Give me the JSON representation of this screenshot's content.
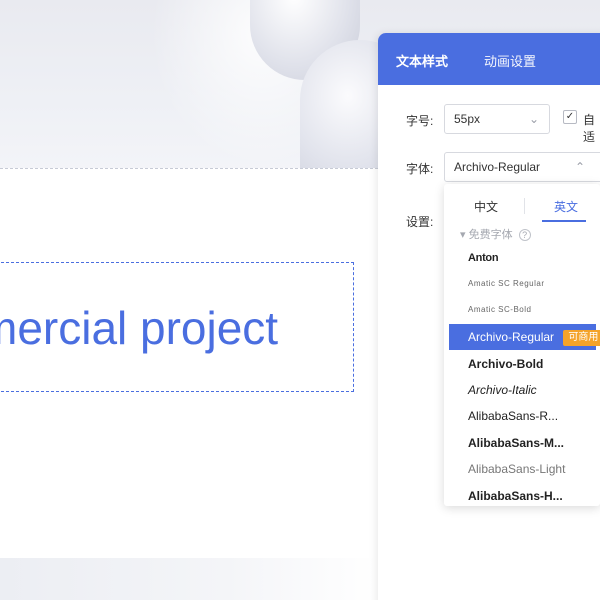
{
  "canvas": {
    "text": "mercial project",
    "text_color": "#4a6ee0"
  },
  "panel": {
    "tabs": [
      {
        "label": "文本样式"
      },
      {
        "label": "动画设置"
      }
    ],
    "accent": "#4a6ee0",
    "font_size": {
      "label": "字号:",
      "value": "55px",
      "auto_label": "自适"
    },
    "font_family": {
      "label": "字体:",
      "value": "Archivo-Regular"
    },
    "settings_label": "设置:"
  },
  "dropdown": {
    "tabs": [
      {
        "label": "中文"
      },
      {
        "label": "英文"
      }
    ],
    "group_label": "免费字体",
    "help_icon": "?",
    "badge": "可商用",
    "fonts": [
      {
        "label": "Anton"
      },
      {
        "label": "Amatic SC Regular"
      },
      {
        "label": "Amatic SC-Bold"
      },
      {
        "label": "Archivo-Regular"
      },
      {
        "label": "Archivo-Bold"
      },
      {
        "label": "Archivo-Italic"
      },
      {
        "label": "AlibabaSans-R..."
      },
      {
        "label": "AlibabaSans-M..."
      },
      {
        "label": "AlibabaSans-Light"
      },
      {
        "label": "AlibabaSans-H..."
      }
    ]
  }
}
